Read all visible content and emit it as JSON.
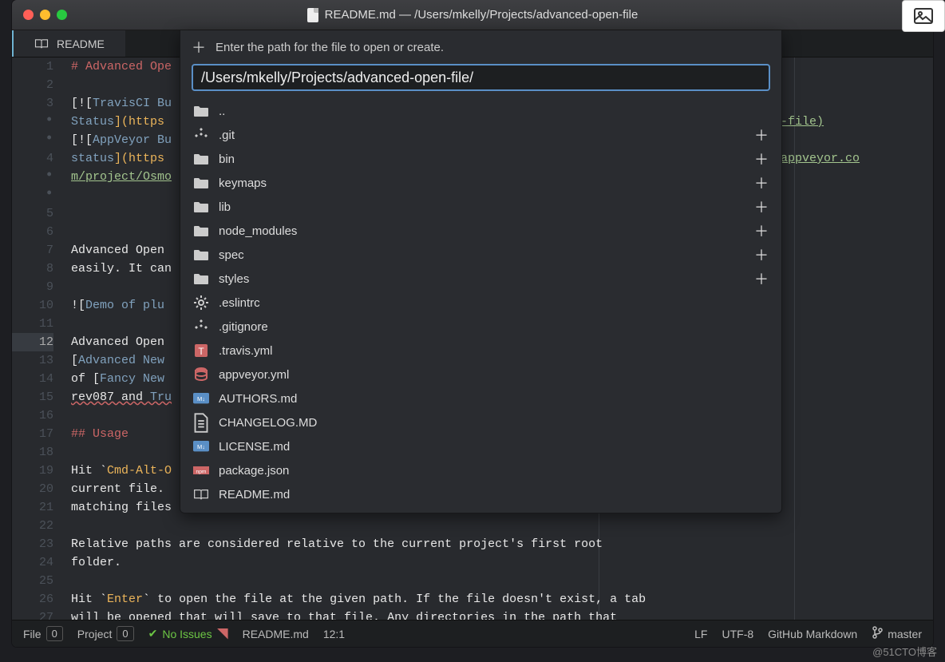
{
  "window": {
    "title": "README.md — /Users/mkelly/Projects/advanced-open-file"
  },
  "tab": {
    "label": "README"
  },
  "overlay": {
    "hint": "Enter the path for the file to open or create.",
    "path": "/Users/mkelly/Projects/advanced-open-file/",
    "items": [
      {
        "name": "..",
        "type": "folder",
        "add": false
      },
      {
        "name": ".git",
        "type": "repo",
        "add": true
      },
      {
        "name": "bin",
        "type": "folder",
        "add": true
      },
      {
        "name": "keymaps",
        "type": "folder",
        "add": true
      },
      {
        "name": "lib",
        "type": "folder",
        "add": true
      },
      {
        "name": "node_modules",
        "type": "folder",
        "add": true
      },
      {
        "name": "spec",
        "type": "folder",
        "add": true
      },
      {
        "name": "styles",
        "type": "folder",
        "add": true
      },
      {
        "name": ".eslintrc",
        "type": "gear",
        "add": false
      },
      {
        "name": ".gitignore",
        "type": "repo",
        "add": false
      },
      {
        "name": ".travis.yml",
        "type": "travis",
        "add": false
      },
      {
        "name": "appveyor.yml",
        "type": "db",
        "add": false
      },
      {
        "name": "AUTHORS.md",
        "type": "md",
        "add": false
      },
      {
        "name": "CHANGELOG.MD",
        "type": "doc",
        "add": false
      },
      {
        "name": "LICENSE.md",
        "type": "md",
        "add": false
      },
      {
        "name": "package.json",
        "type": "npm",
        "add": false
      },
      {
        "name": "README.md",
        "type": "book",
        "add": false
      }
    ]
  },
  "code": {
    "heading1": "# Advanced Ope",
    "travis_link_start": "[![",
    "travis_label": "TravisCI Bu",
    "status1": "Status",
    "url1_a": "](https ",
    "url1_b": "ed-open-file)",
    "appv_label": "AppVeyor Bu",
    "status2": "status",
    "url2_a": "](https ",
    "url2_b": "s://ci.appveyor.co",
    "url2_c": "m/project/Osmo",
    "l8": "Advanced Open ",
    "l9": "easily. It can",
    "l11a": "![",
    "l11b": "Demo of plu",
    "l13": "Advanced Open ",
    "l14a": "[",
    "l14b": "Advanced New ",
    "l15a": "of [",
    "l15b": "Fancy New ",
    "l16a": "rev087 and ",
    "l16b": "Tru",
    "heading2": "## Usage",
    "l20a": "Hit ",
    "l20b": "`",
    "l20c": "Cmd-Alt-O",
    "l21": "current file. ",
    "l22": "matching files",
    "l24": "Relative paths are considered relative to the current project's first root",
    "l25": "folder.",
    "l27a": "Hit ",
    "l27b": "`",
    "l27c": "Enter",
    "l27d": "`",
    "l27e": " to open the file at the given path. If the file doesn't exist, a tab",
    "l28": "will be opened that will save to that file. Any directories in the path that"
  },
  "status": {
    "file": "File",
    "file_n": "0",
    "project": "Project",
    "project_n": "0",
    "issues": "No Issues",
    "filename": "README.md",
    "pos": "12:1",
    "eol": "LF",
    "enc": "UTF-8",
    "grammar": "GitHub Markdown",
    "branch": "master"
  },
  "watermark": "@51CTO博客"
}
